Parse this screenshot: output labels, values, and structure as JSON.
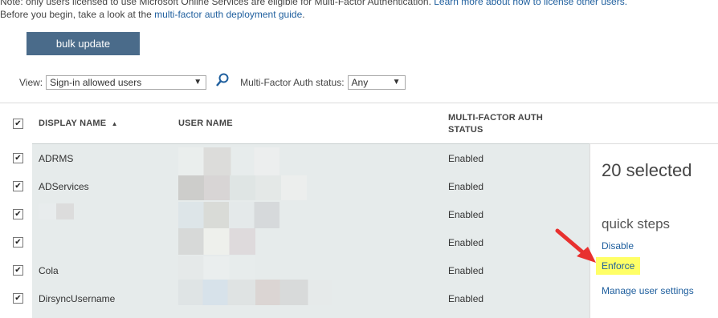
{
  "notice": {
    "line1_prefix": "Note: only users licensed to use Microsoft Online Services are eligible for Multi-Factor Authentication. ",
    "line1_link": "Learn more about how to license other users.",
    "line2_prefix": "Before you begin, take a look at the ",
    "line2_link": "multi-factor auth deployment guide",
    "line2_suffix": "."
  },
  "toolbar": {
    "bulk_update_label": "bulk update"
  },
  "filters": {
    "view_label": "View:",
    "view_value": "Sign-in allowed users",
    "mfa_status_label": "Multi-Factor Auth status:",
    "mfa_status_value": "Any"
  },
  "table": {
    "columns": {
      "display_name": "DISPLAY NAME",
      "user_name": "USER NAME",
      "mfa_status": "MULTI-FACTOR AUTH STATUS"
    },
    "rows": [
      {
        "display_name": "ADRMS",
        "status": "Enabled"
      },
      {
        "display_name": "ADServices",
        "status": "Enabled"
      },
      {
        "display_name": "",
        "status": "Enabled"
      },
      {
        "display_name": "",
        "status": "Enabled"
      },
      {
        "display_name": "Cola",
        "status": "Enabled"
      },
      {
        "display_name": "DirsyncUsername",
        "status": "Enabled"
      }
    ]
  },
  "side_panel": {
    "selected_text": "20 selected",
    "quick_steps_title": "quick steps",
    "links": {
      "disable": "Disable",
      "enforce": "Enforce",
      "manage": "Manage user settings"
    }
  },
  "colors": {
    "accent_button": "#4a6b8a",
    "link": "#1f5f9e",
    "highlight": "#ffff66",
    "annotation_arrow": "#e8312f"
  },
  "icons": {
    "search": "search-icon",
    "sort": "sort-ascending-icon",
    "checkbox": "checkbox-checked-icon",
    "annotation": "red-arrow-annotation"
  }
}
